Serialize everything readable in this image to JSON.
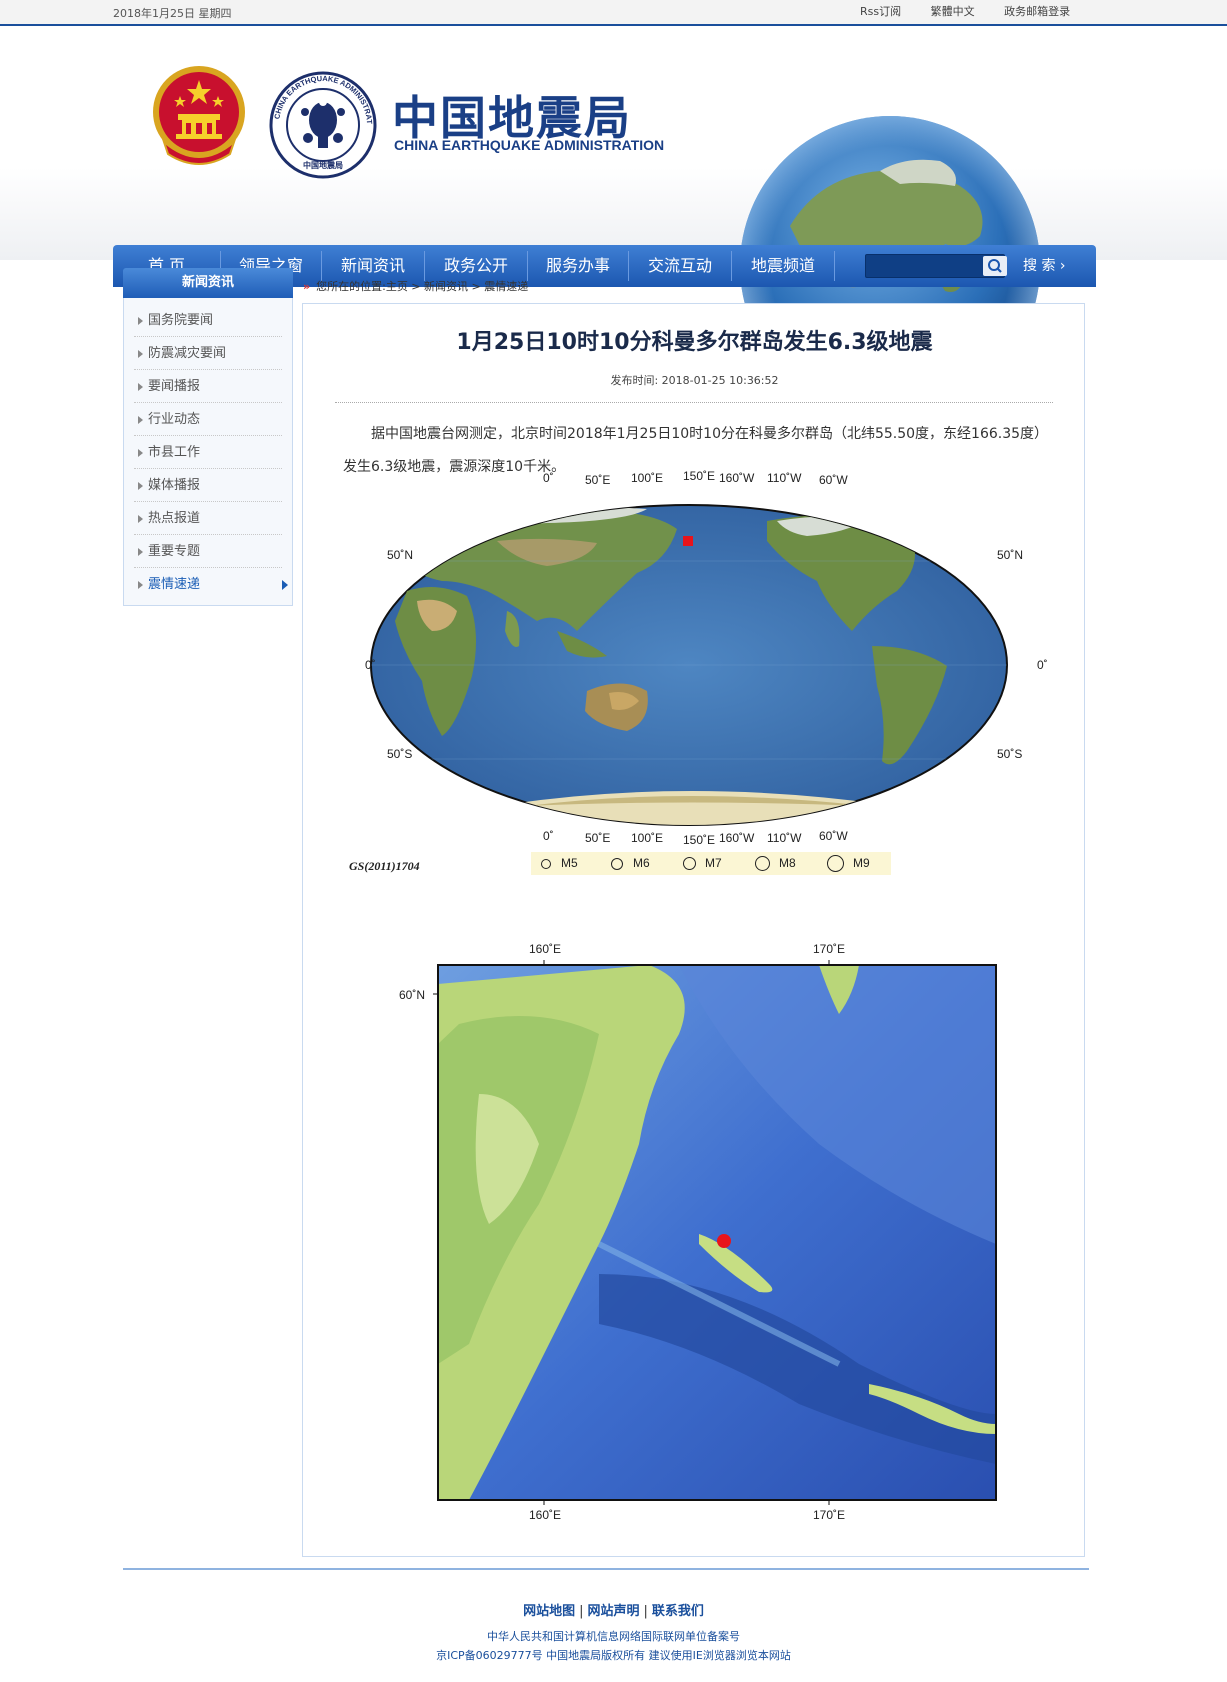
{
  "topbar": {
    "date": "2018年1月25日  星期四",
    "links": [
      "Rss订阅",
      "繁體中文",
      "政务邮箱登录"
    ]
  },
  "header": {
    "brand_cn": "中国地震局",
    "brand_en": "CHINA EARTHQUAKE ADMINISTRATION",
    "logo_ring_text": "CHINA EARTHQUAKE ADMINISTRATION",
    "logo_bottom_text": "中国地震局"
  },
  "nav": {
    "items": [
      "首  页",
      "领导之窗",
      "新闻资讯",
      "政务公开",
      "服务办事",
      "交流互动",
      "地震频道"
    ],
    "search_label": "搜  索 ›",
    "search_placeholder": ""
  },
  "sidebar": {
    "title": "新闻资讯",
    "items": [
      "国务院要闻",
      "防震减灾要闻",
      "要闻播报",
      "行业动态",
      "市县工作",
      "媒体播报",
      "热点报道",
      "重要专题",
      "震情速递"
    ],
    "active": "震情速递"
  },
  "breadcrumb": {
    "arrow": "»",
    "text": "您所在的位置:主页 > 新闻资讯 > 震情速递"
  },
  "article": {
    "title": "1月25日10时10分科曼多尔群岛发生6.3级地震",
    "pubtime": "发布时间: 2018-01-25 10:36:52",
    "body": "据中国地震台网测定，北京时间2018年1月25日10时10分在科曼多尔群岛（北纬55.50度，东经166.35度）发生6.3级地震，震源深度10千米。"
  },
  "world_map": {
    "top_lon_labels": [
      "0˚",
      "50˚E",
      "100˚E",
      "150˚E",
      "160˚W",
      "110˚W",
      "60˚W"
    ],
    "bottom_lon_labels": [
      "0˚",
      "50˚E",
      "100˚E",
      "150˚E",
      "160˚W",
      "110˚W",
      "60˚W"
    ],
    "lat_labels": [
      "50˚N",
      "0˚",
      "50˚S"
    ],
    "gs_code": "GS(2011)1704",
    "legend": [
      "M5",
      "M6",
      "M7",
      "M8",
      "M9"
    ],
    "epicenter_color": "#e8141b"
  },
  "regional_map": {
    "top_lon_labels": [
      "160˚E",
      "170˚E"
    ],
    "bottom_lon_labels": [
      "160˚E",
      "170˚E"
    ],
    "lat_label": "60˚N",
    "epicenter_color": "#e8141b"
  },
  "footer": {
    "links": [
      "网站地图",
      "网站声明",
      "联系我们"
    ],
    "line1": "中华人民共和国计算机信息网络国际联网单位备案号",
    "line2": "京ICP备06029777号  中国地震局版权所有  建议使用IE浏览器浏览本网站"
  },
  "colors": {
    "nav_blue": "#1c57b0",
    "brand_blue": "#1a3f86",
    "link_blue": "#1a4f9c"
  }
}
